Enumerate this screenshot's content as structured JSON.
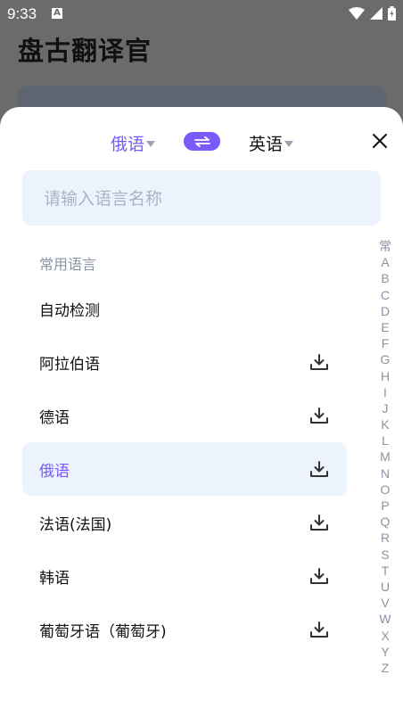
{
  "status_bar": {
    "time": "9:33",
    "a_icon_label": "A"
  },
  "app": {
    "title": "盘古翻译官"
  },
  "lang_bar": {
    "source_language": "俄语",
    "target_language": "英语"
  },
  "search": {
    "placeholder": "请输入语言名称",
    "value": ""
  },
  "list": {
    "section_header": "常用语言",
    "items": [
      {
        "label": "自动检测",
        "downloadable": false,
        "selected": false
      },
      {
        "label": "阿拉伯语",
        "downloadable": true,
        "selected": false
      },
      {
        "label": "德语",
        "downloadable": true,
        "selected": false
      },
      {
        "label": "俄语",
        "downloadable": true,
        "selected": true
      },
      {
        "label": "法语(法国)",
        "downloadable": true,
        "selected": false
      },
      {
        "label": "韩语",
        "downloadable": true,
        "selected": false
      },
      {
        "label": "葡萄牙语（葡萄牙)",
        "downloadable": true,
        "selected": false
      }
    ]
  },
  "alpha_index": [
    "常",
    "A",
    "B",
    "C",
    "D",
    "E",
    "F",
    "G",
    "H",
    "I",
    "J",
    "K",
    "L",
    "M",
    "N",
    "O",
    "P",
    "Q",
    "R",
    "S",
    "T",
    "U",
    "V",
    "W",
    "X",
    "Y",
    "Z"
  ],
  "colors": {
    "accent": "#7a5af8",
    "search_bg": "#edf3fd",
    "muted_text": "#8a93a6",
    "overlay_bg": "#6b6b6b"
  }
}
